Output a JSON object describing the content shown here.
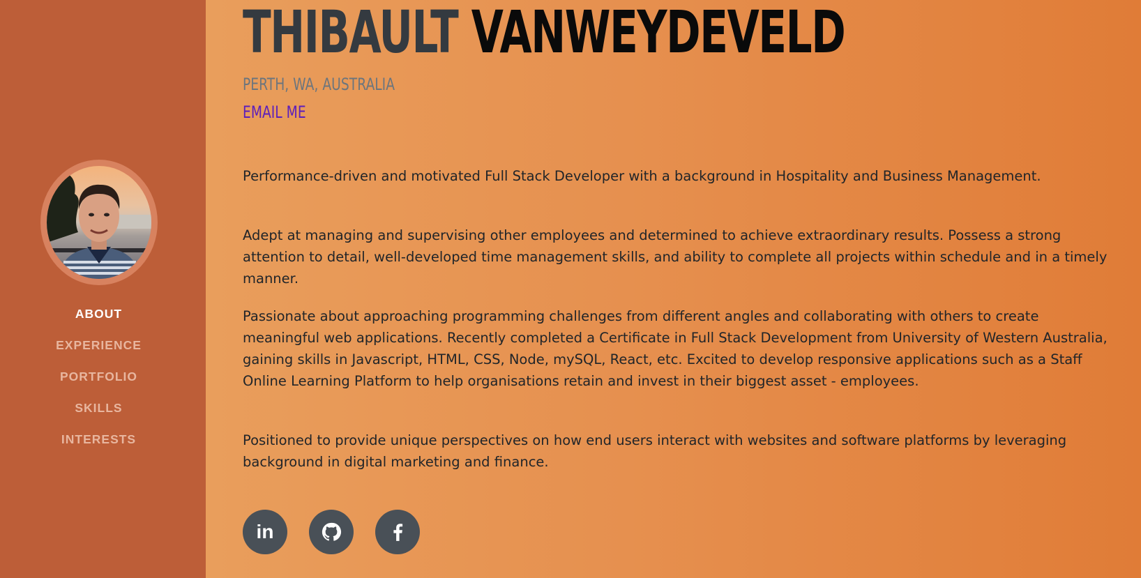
{
  "profile": {
    "first_name": "THIBAULT",
    "last_name": "VANWEYDEVELD",
    "location": "PERTH, WA, AUSTRALIA",
    "email_label": "EMAIL ME"
  },
  "sidebar": {
    "nav": [
      {
        "label": "ABOUT",
        "active": true
      },
      {
        "label": "EXPERIENCE",
        "active": false
      },
      {
        "label": "PORTFOLIO",
        "active": false
      },
      {
        "label": "SKILLS",
        "active": false
      },
      {
        "label": "INTERESTS",
        "active": false
      }
    ]
  },
  "about": {
    "paragraphs": [
      "Performance-driven and motivated Full Stack Developer with a background in Hospitality and Business Management.",
      "Adept at managing and supervising other employees and determined to achieve extraordinary results. Possess a strong attention to detail, well-developed time management skills, and ability to complete all projects within schedule and in a timely manner.",
      "Passionate about approaching programming challenges from different angles and collaborating with others to create meaningful web applications. Recently completed a Certificate in Full Stack Development from University of Western Australia, gaining skills in Javascript, HTML, CSS, Node, mySQL, React, etc. Excited to develop responsive applications such as a Staff Online Learning Platform to help organisations retain and invest in their biggest asset - employees.",
      "Positioned to provide unique perspectives on how end users interact with websites and software platforms by leveraging background in digital marketing and finance."
    ]
  },
  "social": {
    "items": [
      {
        "icon": "linkedin-icon",
        "glyph": "in"
      },
      {
        "icon": "github-icon"
      },
      {
        "icon": "facebook-icon"
      }
    ]
  },
  "colors": {
    "sidebar_bg": "#bd5e38",
    "main_gradient_start": "#e99e5c",
    "main_gradient_end": "#e07c37",
    "social_bg": "#495057",
    "email_link": "#5b1ebc"
  }
}
